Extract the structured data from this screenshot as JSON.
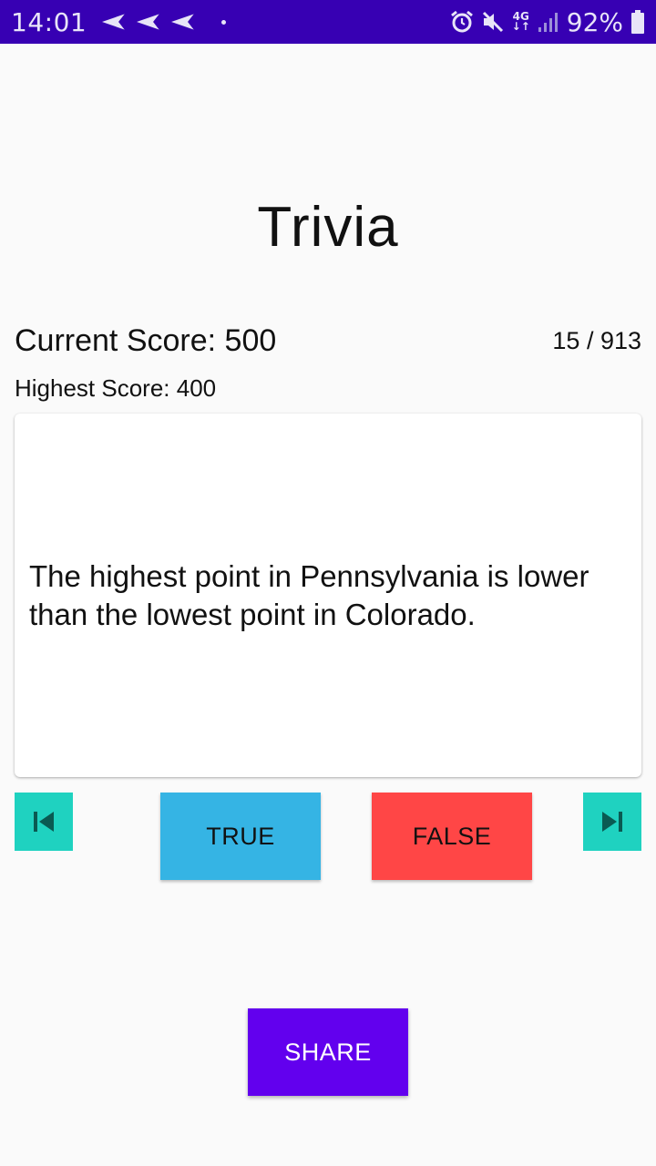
{
  "status_bar": {
    "time": "14:01",
    "network_label_top": "4G",
    "network_label_bottom": "↓↑",
    "battery_percent": "92%",
    "icons": [
      "send-icon",
      "send-icon",
      "send-icon",
      "notification-dot",
      "alarm-icon",
      "mute-icon",
      "network-4g-icon",
      "signal-icon",
      "battery-icon"
    ]
  },
  "app": {
    "title": "Trivia"
  },
  "scores": {
    "current": "Current Score: 500",
    "highest": "Highest Score: 400",
    "counter": "15 / 913"
  },
  "question": {
    "text": "The highest point in Pennsylvania is lower than the lowest point in Colorado."
  },
  "buttons": {
    "prev_icon": "skip-previous-icon",
    "next_icon": "skip-next-icon",
    "true_label": "TRUE",
    "false_label": "FALSE",
    "share_label": "SHARE"
  },
  "colors": {
    "status_bar": "#3700b3",
    "nav_button": "#1fd2c0",
    "true_button": "#35b4e4",
    "false_button": "#ff4646",
    "share_button": "#6200ee"
  }
}
